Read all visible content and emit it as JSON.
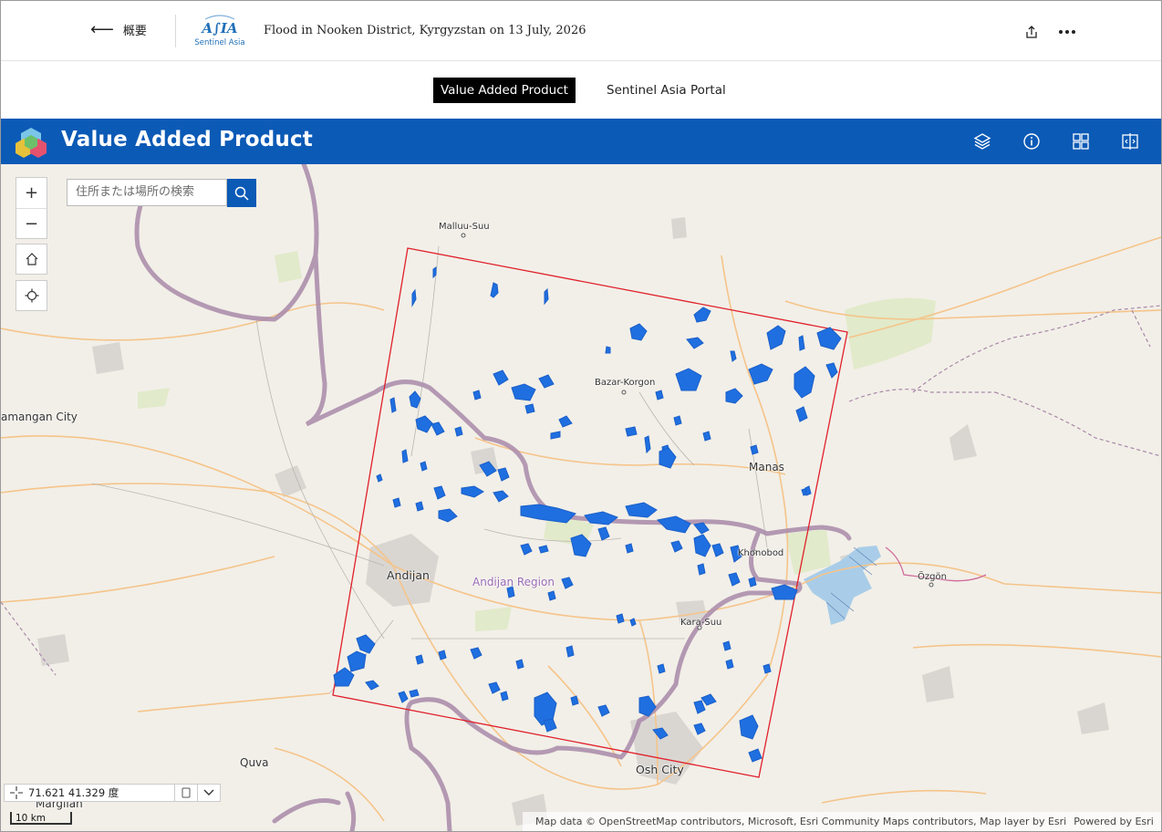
{
  "header": {
    "back_label": "概要",
    "logo_text": "Sentinel Asia",
    "title": "Flood in Nooken District, Kyrgyzstan on 13 July, 2026",
    "share_icon": "share-icon",
    "more_icon": "more-options-icon"
  },
  "nav": {
    "tabs": [
      {
        "label": "Value Added Product",
        "active": true
      },
      {
        "label": "Sentinel Asia Portal",
        "active": false
      }
    ]
  },
  "app": {
    "title": "Value Added Product",
    "tools": [
      "layers-icon",
      "info-icon",
      "basemap-gallery-icon",
      "swipe-compare-icon"
    ],
    "brand_color": "#0b5ab6"
  },
  "map": {
    "search_placeholder": "住所または場所の検索",
    "zoom_in": "+",
    "zoom_out": "−",
    "labels": {
      "malluu_suu": "Malluu-Suu",
      "bazar_korgon": "Bazar-Korgon",
      "namangan": "amangan City",
      "manas": "Manas",
      "khonobod": "Khonobod",
      "ozgon": "Özgön",
      "andijan": "Andijan",
      "andijan_region": "Andijan Region",
      "kara_suu": "Kara-Suu",
      "quva": "Quva",
      "osh": "Osh City",
      "margilan": "Margilan"
    },
    "coordinates": "71.621 41.329 度",
    "scale": "10 km",
    "attribution": "Map data © OpenStreetMap contributors, Microsoft, Esri Community Maps contributors, Map layer by Esri",
    "powered_by": "Powered by Esri",
    "colors": {
      "aoi_outline": "#e0202a",
      "flood_polygons": "#1f6fe0",
      "border": "#a07aa4",
      "roads": "#f5c48a",
      "water": "#a9cde8"
    }
  }
}
